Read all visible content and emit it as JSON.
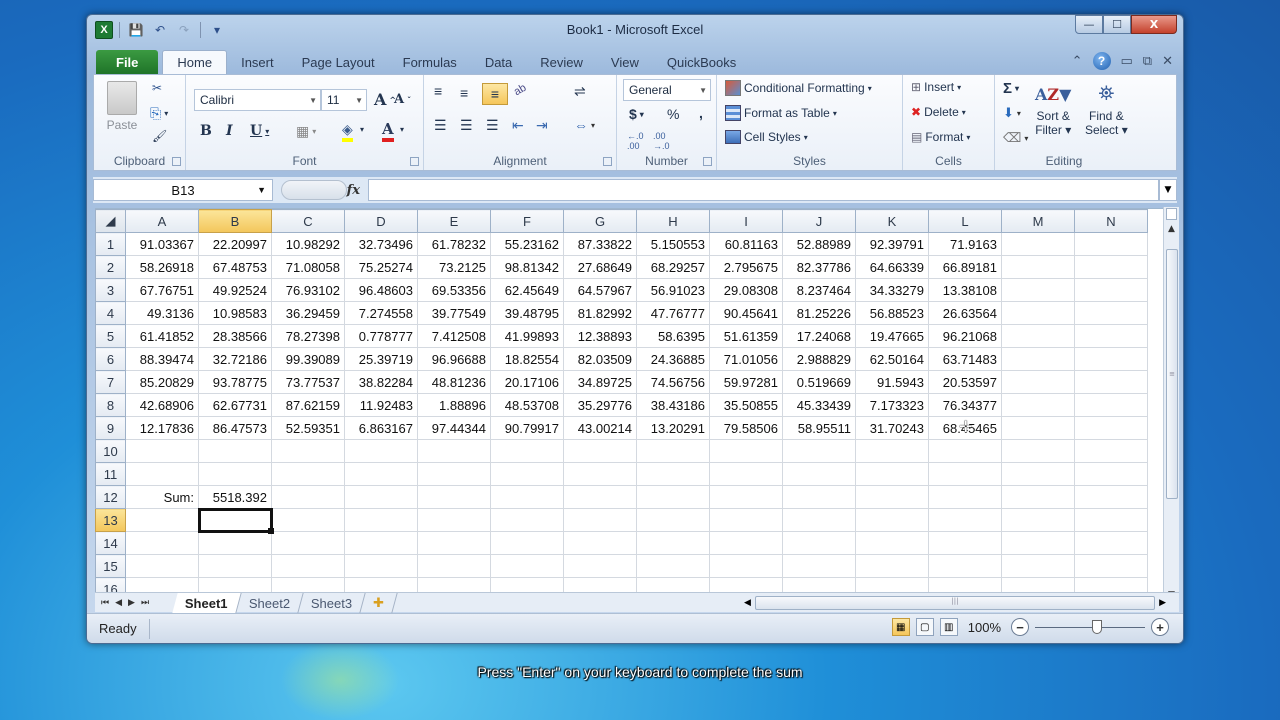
{
  "window": {
    "title": "Book1 - Microsoft Excel",
    "app_icon": "X",
    "controls": {
      "minimize": "—",
      "maximize": "☐",
      "close": "X"
    }
  },
  "qat": {
    "save_icon": "💾",
    "undo_icon": "↶",
    "redo_icon": "↷",
    "customize_icon": "▾"
  },
  "tabs": [
    {
      "label": "File"
    },
    {
      "label": "Home"
    },
    {
      "label": "Insert"
    },
    {
      "label": "Page Layout"
    },
    {
      "label": "Formulas"
    },
    {
      "label": "Data"
    },
    {
      "label": "Review"
    },
    {
      "label": "View"
    },
    {
      "label": "QuickBooks"
    }
  ],
  "tab_right": {
    "collapse": "⌃",
    "help": "?",
    "min": "▭",
    "restore": "⧉",
    "close": "✕"
  },
  "ribbon": {
    "clipboard": {
      "label": "Clipboard",
      "paste": "Paste",
      "cut_icon": "✂",
      "copy_icon": "⎘",
      "painter_icon": "🖌"
    },
    "font": {
      "label": "Font",
      "name": "Calibri",
      "size": "11",
      "grow": "A",
      "shrink": "A",
      "bold": "B",
      "italic": "I",
      "underline": "U",
      "border_icon": "▦",
      "fill_icon": "◈",
      "color_icon": "A"
    },
    "alignment": {
      "label": "Alignment",
      "orientation_icon": "ab",
      "wrap_icon": "⇌",
      "merge_icon": "⇔"
    },
    "number": {
      "label": "Number",
      "format": "General",
      "currency": "$",
      "percent": "%",
      "comma": ",",
      "inc_decimal": ".0→.00",
      "dec_decimal": ".00→.0"
    },
    "styles": {
      "label": "Styles",
      "conditional": "Conditional Formatting",
      "format_table": "Format as Table",
      "cell_styles": "Cell Styles"
    },
    "cells": {
      "label": "Cells",
      "insert": "Insert",
      "delete": "Delete",
      "format": "Format"
    },
    "editing": {
      "label": "Editing",
      "autosum": "Σ",
      "fill_icon": "⬇",
      "clear_icon": "⌫",
      "sort": "Sort &",
      "sort2": "Filter",
      "find": "Find &",
      "find2": "Select"
    }
  },
  "formula_bar": {
    "name_box": "B13",
    "fx": "fx",
    "formula": ""
  },
  "grid": {
    "columns": [
      "A",
      "B",
      "C",
      "D",
      "E",
      "F",
      "G",
      "H",
      "I",
      "J",
      "K",
      "L",
      "M",
      "N"
    ],
    "selected_column": "B",
    "selected_row": 13,
    "active_cell": "B13",
    "rows": [
      {
        "n": "1",
        "cells": [
          "91.03367",
          "22.20997",
          "10.98292",
          "32.73496",
          "61.78232",
          "55.23162",
          "87.33822",
          "5.150553",
          "60.81163",
          "52.88989",
          "92.39791",
          "71.9163",
          "",
          ""
        ]
      },
      {
        "n": "2",
        "cells": [
          "58.26918",
          "67.48753",
          "71.08058",
          "75.25274",
          "73.2125",
          "98.81342",
          "27.68649",
          "68.29257",
          "2.795675",
          "82.37786",
          "64.66339",
          "66.89181",
          "",
          ""
        ]
      },
      {
        "n": "3",
        "cells": [
          "67.76751",
          "49.92524",
          "76.93102",
          "96.48603",
          "69.53356",
          "62.45649",
          "64.57967",
          "56.91023",
          "29.08308",
          "8.237464",
          "34.33279",
          "13.38108",
          "",
          ""
        ]
      },
      {
        "n": "4",
        "cells": [
          "49.3136",
          "10.98583",
          "36.29459",
          "7.274558",
          "39.77549",
          "39.48795",
          "81.82992",
          "47.76777",
          "90.45641",
          "81.25226",
          "56.88523",
          "26.63564",
          "",
          ""
        ]
      },
      {
        "n": "5",
        "cells": [
          "61.41852",
          "28.38566",
          "78.27398",
          "0.778777",
          "7.412508",
          "41.99893",
          "12.38893",
          "58.6395",
          "51.61359",
          "17.24068",
          "19.47665",
          "96.21068",
          "",
          ""
        ]
      },
      {
        "n": "6",
        "cells": [
          "88.39474",
          "32.72186",
          "99.39089",
          "25.39719",
          "96.96688",
          "18.82554",
          "82.03509",
          "24.36885",
          "71.01056",
          "2.988829",
          "62.50164",
          "63.71483",
          "",
          ""
        ]
      },
      {
        "n": "7",
        "cells": [
          "85.20829",
          "93.78775",
          "73.77537",
          "38.82284",
          "48.81236",
          "20.17106",
          "34.89725",
          "74.56756",
          "59.97281",
          "0.519669",
          "91.5943",
          "20.53597",
          "",
          ""
        ]
      },
      {
        "n": "8",
        "cells": [
          "42.68906",
          "62.67731",
          "87.62159",
          "11.92483",
          "1.88896",
          "48.53708",
          "35.29776",
          "38.43186",
          "35.50855",
          "45.33439",
          "7.173323",
          "76.34377",
          "",
          ""
        ]
      },
      {
        "n": "9",
        "cells": [
          "12.17836",
          "86.47573",
          "52.59351",
          "6.863167",
          "97.44344",
          "90.79917",
          "43.00214",
          "13.20291",
          "79.58506",
          "58.95511",
          "31.70243",
          "68.45465",
          "",
          ""
        ]
      },
      {
        "n": "10",
        "cells": [
          "",
          "",
          "",
          "",
          "",
          "",
          "",
          "",
          "",
          "",
          "",
          "",
          "",
          ""
        ]
      },
      {
        "n": "11",
        "cells": [
          "",
          "",
          "",
          "",
          "",
          "",
          "",
          "",
          "",
          "",
          "",
          "",
          "",
          ""
        ]
      },
      {
        "n": "12",
        "cells": [
          "Sum:",
          "5518.392",
          "",
          "",
          "",
          "",
          "",
          "",
          "",
          "",
          "",
          "",
          "",
          ""
        ]
      },
      {
        "n": "13",
        "cells": [
          "",
          "",
          "",
          "",
          "",
          "",
          "",
          "",
          "",
          "",
          "",
          "",
          "",
          ""
        ]
      },
      {
        "n": "14",
        "cells": [
          "",
          "",
          "",
          "",
          "",
          "",
          "",
          "",
          "",
          "",
          "",
          "",
          "",
          ""
        ]
      },
      {
        "n": "15",
        "cells": [
          "",
          "",
          "",
          "",
          "",
          "",
          "",
          "",
          "",
          "",
          "",
          "",
          "",
          ""
        ]
      },
      {
        "n": "16",
        "cells": [
          "",
          "",
          "",
          "",
          "",
          "",
          "",
          "",
          "",
          "",
          "",
          "",
          "",
          ""
        ]
      }
    ]
  },
  "sheets": [
    {
      "label": "Sheet1",
      "active": true
    },
    {
      "label": "Sheet2"
    },
    {
      "label": "Sheet3"
    }
  ],
  "sheet_nav": [
    "⏮",
    "◀",
    "▶",
    "⏭"
  ],
  "status": {
    "ready": "Ready",
    "zoom": "100%",
    "zoom_level_percent": 100
  },
  "caption": "Press \"Enter\" on your keyboard to complete the sum"
}
